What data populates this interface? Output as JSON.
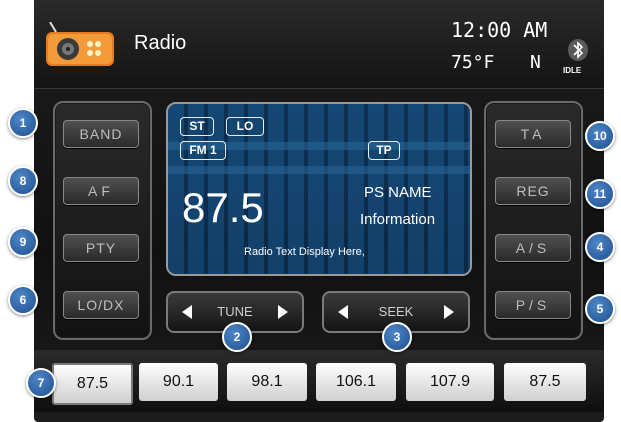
{
  "header": {
    "title": "Radio",
    "clock": "12:00 AM",
    "temperature": "75°F",
    "direction": "N",
    "bt_status": "IDLE"
  },
  "left_buttons": [
    "BAND",
    "AF",
    "PTY",
    "LO/DX"
  ],
  "right_buttons": [
    "TA",
    "REG",
    "A/S",
    "P/S"
  ],
  "display": {
    "tags": [
      "ST",
      "LO",
      "FM 1",
      "TP"
    ],
    "frequency": "87.5",
    "ps_name": "PS NAME",
    "info": "Information",
    "radio_text": "Radio Text Display Here,"
  },
  "tune_label": "TUNE",
  "seek_label": "SEEK",
  "presets": [
    "87.5",
    "90.1",
    "98.1",
    "106.1",
    "107.9",
    "87.5"
  ],
  "badges": {
    "band": "1",
    "af": "8",
    "pty": "9",
    "lodx": "6",
    "preset": "7",
    "tune": "2",
    "seek": "3",
    "ta": "10",
    "reg": "11",
    "as": "4",
    "ps": "5"
  },
  "colors": {
    "badge_blue": "#2a63a8",
    "display_blue": "#1b4a73",
    "preset_bg": "#f2f2f2"
  },
  "icons": [
    "radio-app-icon",
    "bluetooth-icon",
    "chevron-left-icon",
    "chevron-right-icon"
  ]
}
